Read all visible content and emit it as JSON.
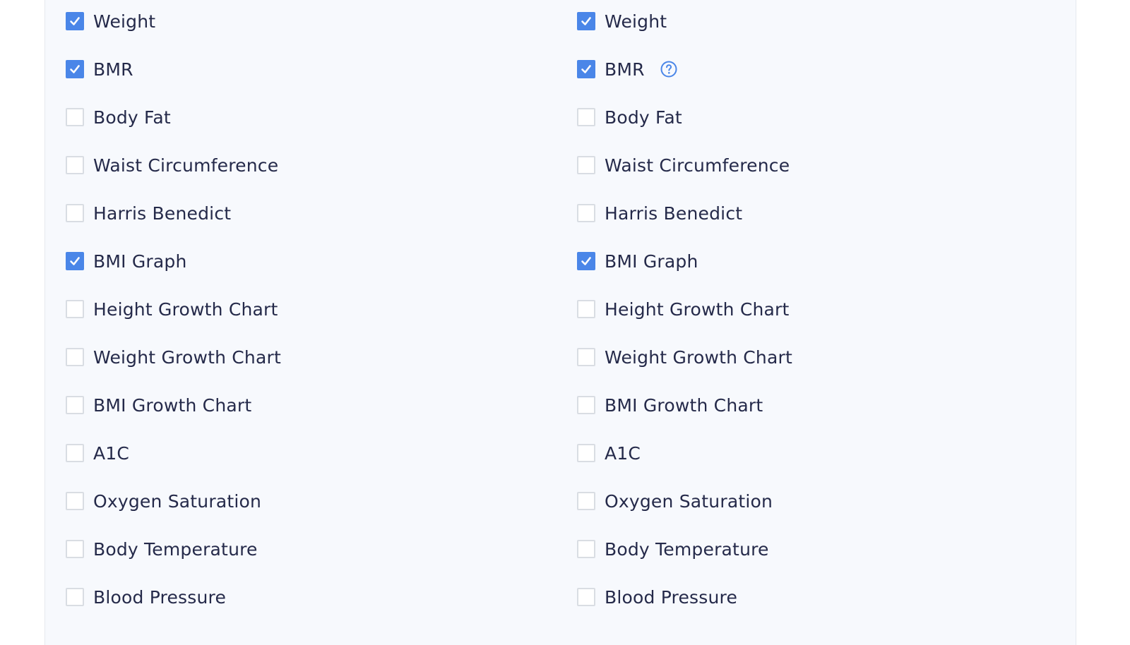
{
  "colors": {
    "accent": "#4a86e8",
    "text": "#252a4a",
    "panel_background": "#f7f9fd",
    "checkbox_border": "#d9dde3"
  },
  "left_column": {
    "items": [
      {
        "label": "Weight",
        "checked": true
      },
      {
        "label": "BMR",
        "checked": true
      },
      {
        "label": "Body Fat",
        "checked": false
      },
      {
        "label": "Waist Circumference",
        "checked": false
      },
      {
        "label": "Harris Benedict",
        "checked": false
      },
      {
        "label": "BMI Graph",
        "checked": true
      },
      {
        "label": "Height Growth Chart",
        "checked": false
      },
      {
        "label": "Weight Growth Chart",
        "checked": false
      },
      {
        "label": "BMI Growth Chart",
        "checked": false
      },
      {
        "label": "A1C",
        "checked": false
      },
      {
        "label": "Oxygen Saturation",
        "checked": false
      },
      {
        "label": "Body Temperature",
        "checked": false
      },
      {
        "label": "Blood Pressure",
        "checked": false
      }
    ]
  },
  "right_column": {
    "items": [
      {
        "label": "Weight",
        "checked": true
      },
      {
        "label": "BMR",
        "checked": true,
        "icon": "help-circle-icon"
      },
      {
        "label": "Body Fat",
        "checked": false
      },
      {
        "label": "Waist Circumference",
        "checked": false
      },
      {
        "label": "Harris Benedict",
        "checked": false
      },
      {
        "label": "BMI Graph",
        "checked": true
      },
      {
        "label": "Height Growth Chart",
        "checked": false
      },
      {
        "label": "Weight Growth Chart",
        "checked": false
      },
      {
        "label": "BMI Growth Chart",
        "checked": false
      },
      {
        "label": "A1C",
        "checked": false
      },
      {
        "label": "Oxygen Saturation",
        "checked": false
      },
      {
        "label": "Body Temperature",
        "checked": false
      },
      {
        "label": "Blood Pressure",
        "checked": false
      }
    ]
  }
}
